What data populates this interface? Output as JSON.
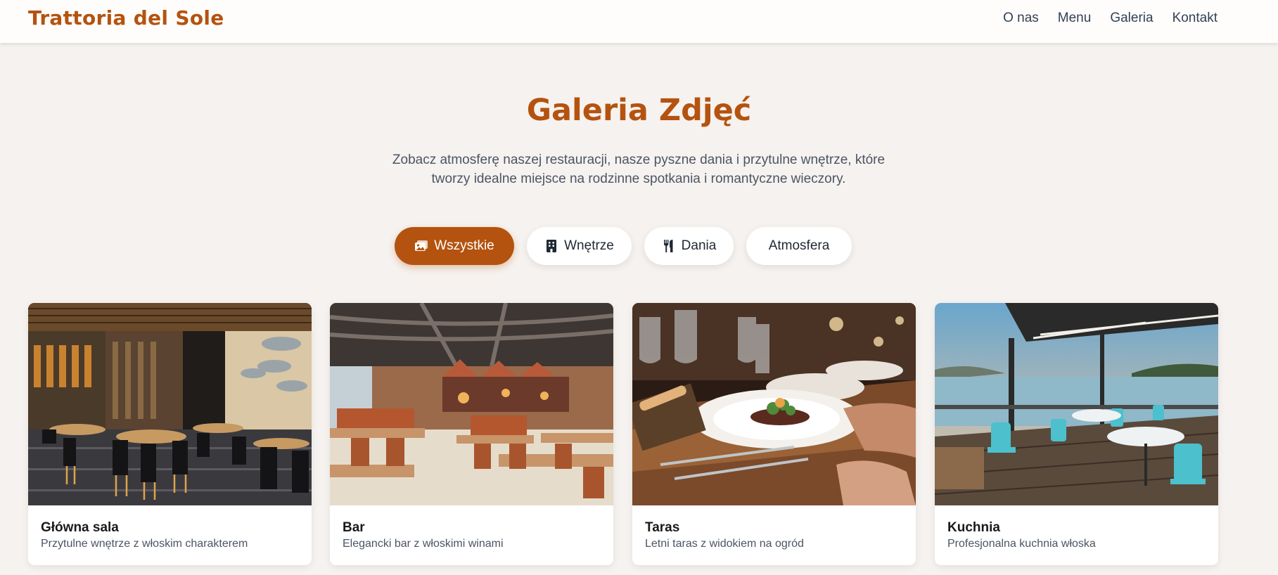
{
  "brand": "Trattoria del Sole",
  "nav": [
    "O nas",
    "Menu",
    "Galeria",
    "Kontakt"
  ],
  "hero": {
    "title": "Galeria Zdjęć",
    "subtitle_line1": "Zobacz atmosferę naszej restauracji, nasze pyszne dania i przytulne wnętrze, które",
    "subtitle_line2": "tworzy idealne miejsce na rodzinne spotkania i romantyczne wieczory."
  },
  "filters": [
    {
      "label": "Wszystkie",
      "icon": "images-icon",
      "active": true
    },
    {
      "label": "Wnętrze",
      "icon": "building-icon",
      "active": false
    },
    {
      "label": "Dania",
      "icon": "utensils-icon",
      "active": false
    },
    {
      "label": "Atmosfera",
      "icon": "",
      "active": false
    }
  ],
  "gallery": [
    {
      "title": "Główna sala",
      "description": "Przytulne wnętrze z włoskim charakterem",
      "image": "restaurant-dining-hall-photo"
    },
    {
      "title": "Bar",
      "description": "Elegancki bar z włoskimi winami",
      "image": "restaurant-bar-photo"
    },
    {
      "title": "Taras",
      "description": "Letni taras z widokiem na ogród",
      "image": "plated-dish-table-photo"
    },
    {
      "title": "Kuchnia",
      "description": "Profesjonalna kuchnia włoska",
      "image": "lakeside-terrace-photo"
    }
  ],
  "colors": {
    "accent": "#b4530f",
    "background": "#f6f2ef",
    "card": "#ffffff",
    "text_muted": "#4b5563"
  }
}
